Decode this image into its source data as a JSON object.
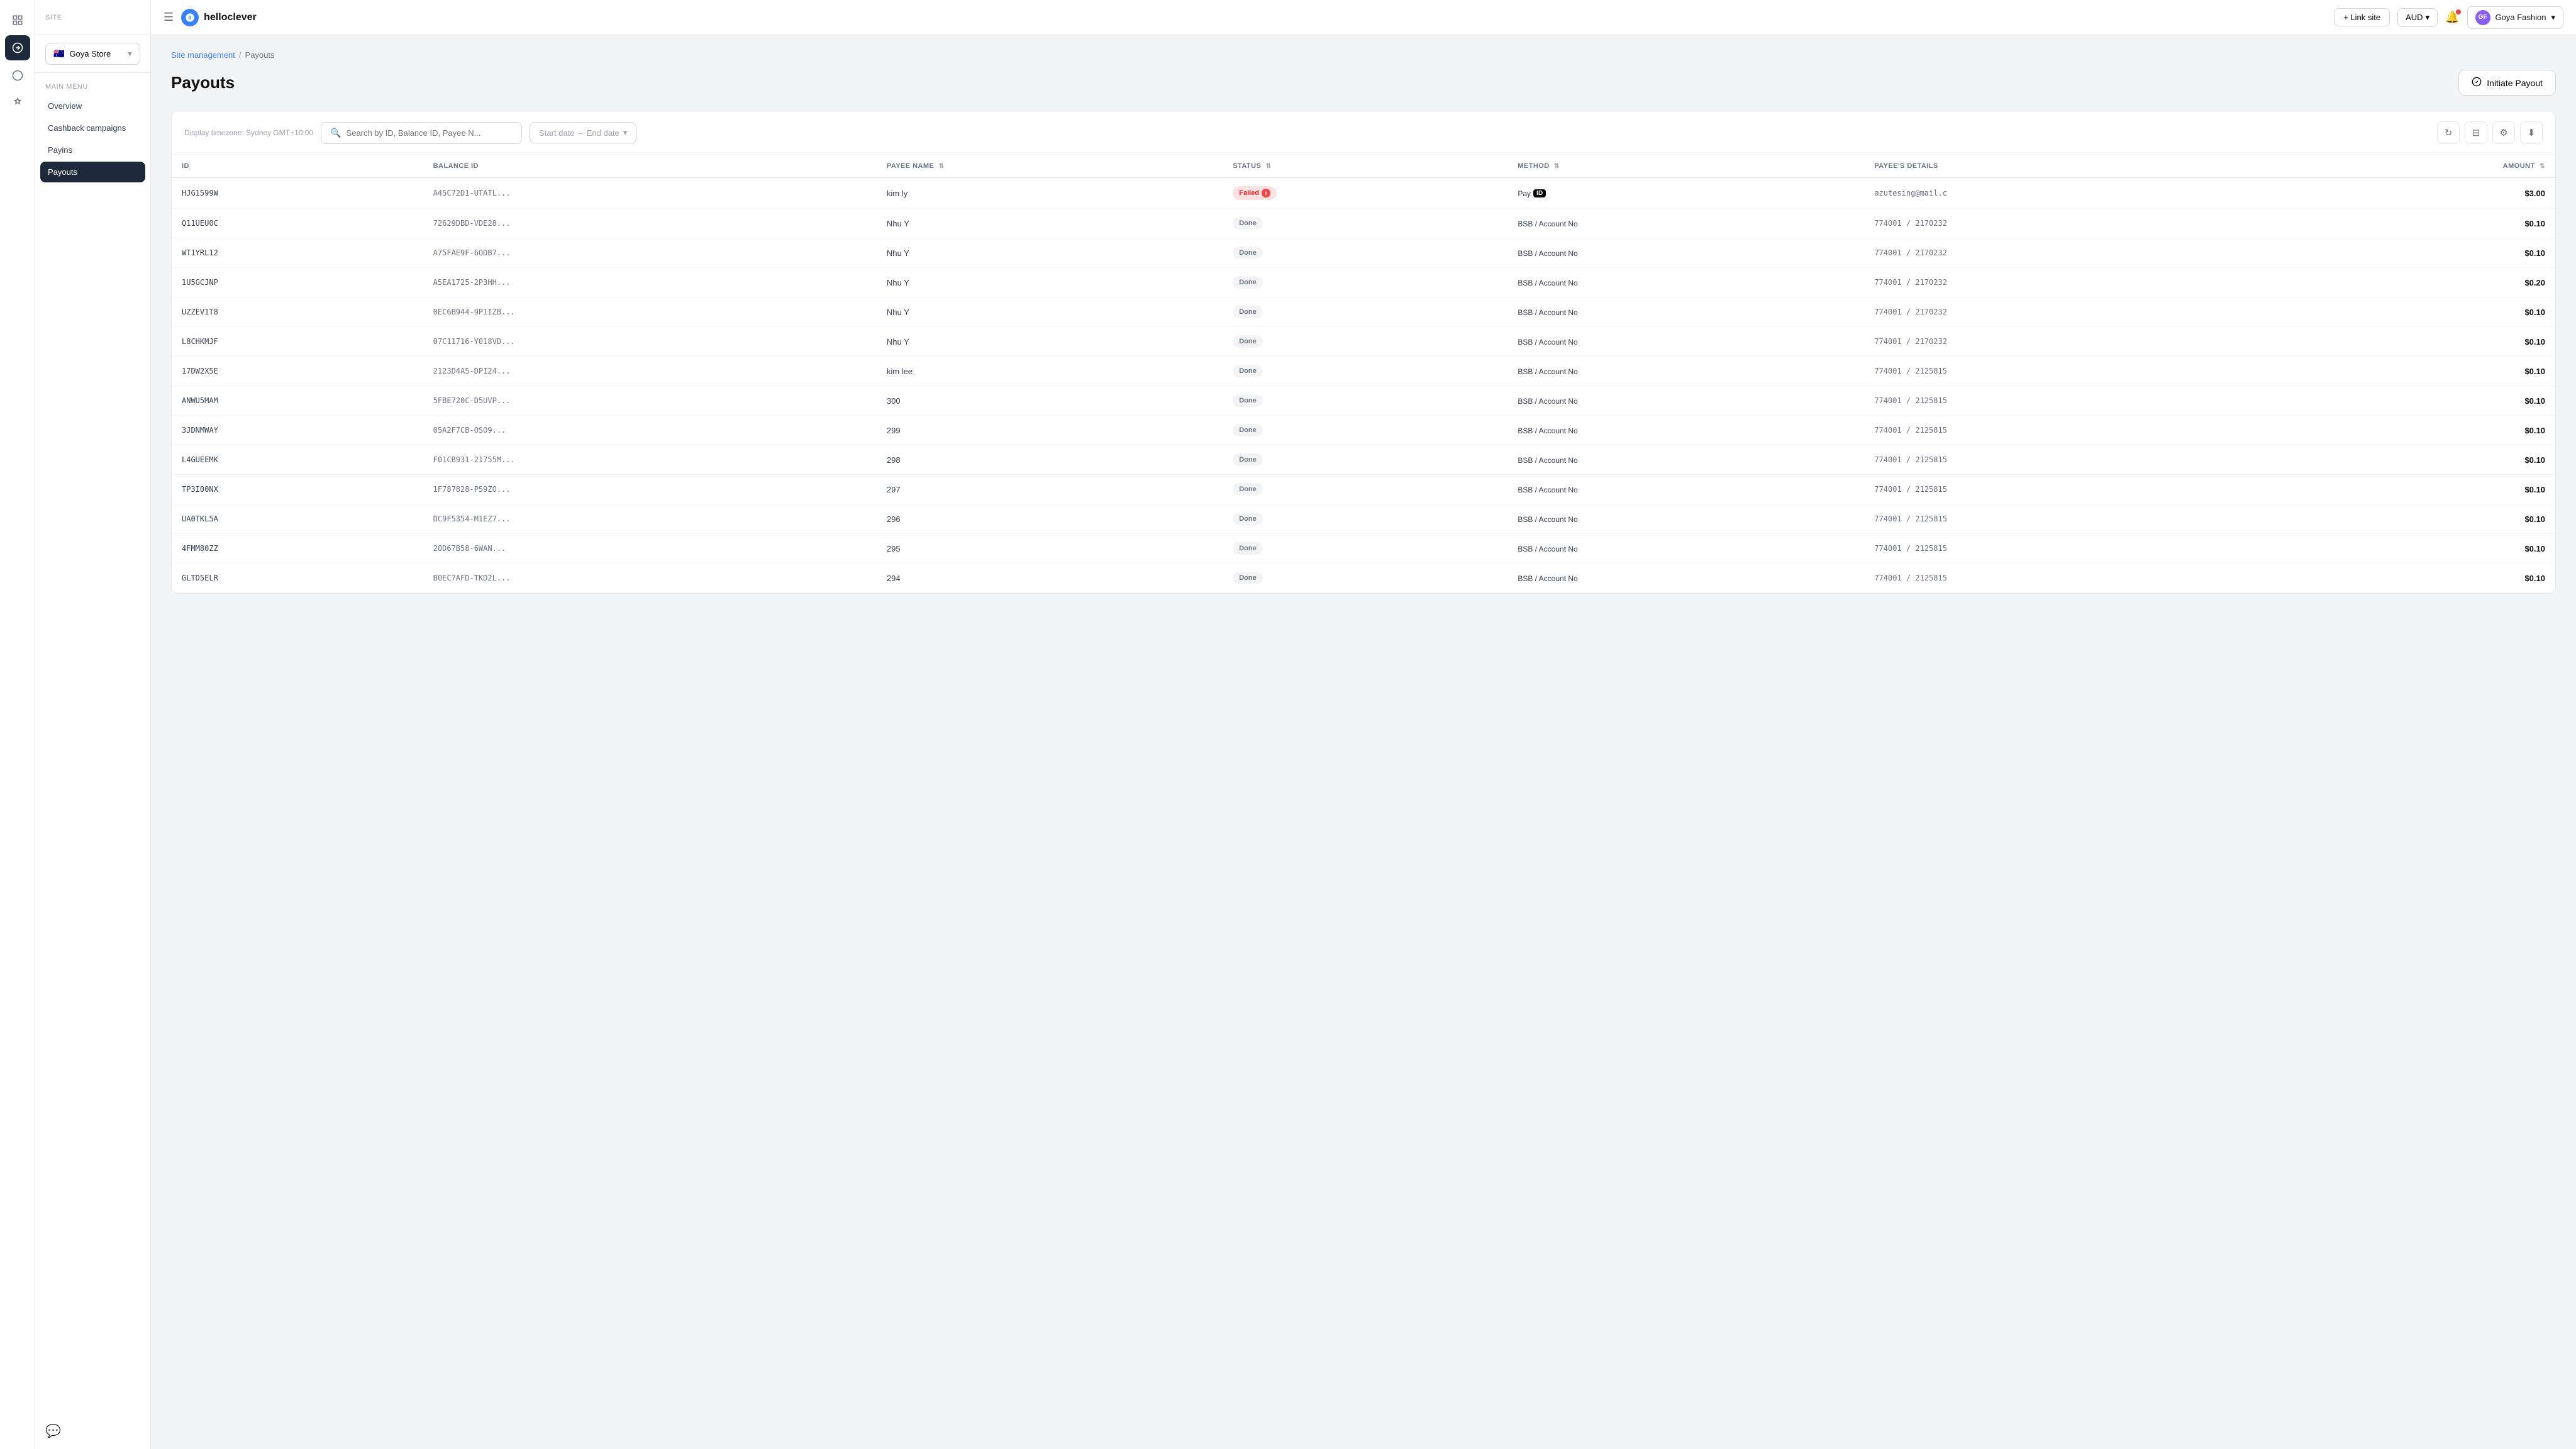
{
  "app": {
    "brand_name": "helloclever",
    "brand_icon_text": "hc"
  },
  "topbar": {
    "menu_icon": "☰",
    "link_site_label": "+ Link site",
    "currency_label": "AUD",
    "currency_dropdown_icon": "▾",
    "notification_icon": "🔔",
    "user_name": "Goya Fashion",
    "user_avatar_text": "GF",
    "user_dropdown_icon": "▾"
  },
  "sidebar": {
    "site_section_label": "SITE",
    "site_name": "Goya Store",
    "site_flag": "🇦🇺",
    "site_dropdown_icon": "▾",
    "nav_section_label": "MAIN MENU",
    "nav_items": [
      {
        "id": "overview",
        "label": "Overview",
        "active": false
      },
      {
        "id": "cashback",
        "label": "Cashback campaigns",
        "active": false
      },
      {
        "id": "payins",
        "label": "Payins",
        "active": false
      },
      {
        "id": "payouts",
        "label": "Payouts",
        "active": true
      }
    ],
    "collapse_icon": "‹",
    "support_icon": "💬"
  },
  "page": {
    "breadcrumb_site_management": "Site management",
    "breadcrumb_separator": "/",
    "breadcrumb_current": "Payouts",
    "title": "Payouts",
    "initiate_button_label": "Initiate Payout",
    "initiate_button_icon": "⊙"
  },
  "toolbar": {
    "timezone_label": "Display timezone: Sydney GMT+10:00",
    "search_placeholder": "Search by ID, Balance ID, Payee N...",
    "date_start_placeholder": "Start date",
    "date_end_placeholder": "End date",
    "date_separator": "–",
    "refresh_icon": "↻",
    "filter_icon": "⊟",
    "settings_icon": "⚙",
    "download_icon": "⬇"
  },
  "table": {
    "columns": [
      {
        "id": "id",
        "label": "ID"
      },
      {
        "id": "balance_id",
        "label": "BALANCE ID"
      },
      {
        "id": "payee_name",
        "label": "PAYEE NAME",
        "sortable": true
      },
      {
        "id": "status",
        "label": "STATUS",
        "sortable": true
      },
      {
        "id": "method",
        "label": "METHOD",
        "sortable": true
      },
      {
        "id": "payee_details",
        "label": "PAYEE'S DETAILS"
      },
      {
        "id": "amount",
        "label": "AMOUNT",
        "sortable": true
      }
    ],
    "rows": [
      {
        "id": "HJG1599W",
        "balance_id": "A45C72D1-UTATL...",
        "payee_name": "kim ly",
        "status": "Failed",
        "status_type": "failed",
        "method": "Pay",
        "method_badge": "ID",
        "payee_details": "azutesing@mail.c",
        "amount": "$3.00"
      },
      {
        "id": "Q11UEU0C",
        "balance_id": "72629DBD-VDE28...",
        "payee_name": "Nhu Y",
        "status": "Done",
        "status_type": "done",
        "method": "BSB / Account No",
        "method_badge": "",
        "payee_details": "774001 / 2170232",
        "amount": "$0.10"
      },
      {
        "id": "WT1YRL12",
        "balance_id": "A75FAE9F-6ODB7...",
        "payee_name": "Nhu Y",
        "status": "Done",
        "status_type": "done",
        "method": "BSB / Account No",
        "method_badge": "",
        "payee_details": "774001 / 2170232",
        "amount": "$0.10"
      },
      {
        "id": "1U5GCJNP",
        "balance_id": "A5EA1725-2P3HH...",
        "payee_name": "Nhu Y",
        "status": "Done",
        "status_type": "done",
        "method": "BSB / Account No",
        "method_badge": "",
        "payee_details": "774001 / 2170232",
        "amount": "$0.20"
      },
      {
        "id": "UZZEV1T8",
        "balance_id": "0EC6B944-9P1IZB...",
        "payee_name": "Nhu Y",
        "status": "Done",
        "status_type": "done",
        "method": "BSB / Account No",
        "method_badge": "",
        "payee_details": "774001 / 2170232",
        "amount": "$0.10"
      },
      {
        "id": "L8CHKMJF",
        "balance_id": "07C11716-Y018VD...",
        "payee_name": "Nhu Y",
        "status": "Done",
        "status_type": "done",
        "method": "BSB / Account No",
        "method_badge": "",
        "payee_details": "774001 / 2170232",
        "amount": "$0.10"
      },
      {
        "id": "17DW2X5E",
        "balance_id": "2123D4A5-DPI24...",
        "payee_name": "kim lee",
        "status": "Done",
        "status_type": "done",
        "method": "BSB / Account No",
        "method_badge": "",
        "payee_details": "774001 / 2125815",
        "amount": "$0.10"
      },
      {
        "id": "ANWU5MAM",
        "balance_id": "5FBE720C-D5UVP...",
        "payee_name": "300",
        "status": "Done",
        "status_type": "done",
        "method": "BSB / Account No",
        "method_badge": "",
        "payee_details": "774001 / 2125815",
        "amount": "$0.10"
      },
      {
        "id": "3JDNMWAY",
        "balance_id": "05A2F7CB-OSO9...",
        "payee_name": "299",
        "status": "Done",
        "status_type": "done",
        "method": "BSB / Account No",
        "method_badge": "",
        "payee_details": "774001 / 2125815",
        "amount": "$0.10"
      },
      {
        "id": "L4GUEEMK",
        "balance_id": "F01CB931-21755M...",
        "payee_name": "298",
        "status": "Done",
        "status_type": "done",
        "method": "BSB / Account No",
        "method_badge": "",
        "payee_details": "774001 / 2125815",
        "amount": "$0.10"
      },
      {
        "id": "TP3I00NX",
        "balance_id": "1F787828-P59ZO...",
        "payee_name": "297",
        "status": "Done",
        "status_type": "done",
        "method": "BSB / Account No",
        "method_badge": "",
        "payee_details": "774001 / 2125815",
        "amount": "$0.10"
      },
      {
        "id": "UA0TKL5A",
        "balance_id": "DC9F5354-M1EZ7...",
        "payee_name": "296",
        "status": "Done",
        "status_type": "done",
        "method": "BSB / Account No",
        "method_badge": "",
        "payee_details": "774001 / 2125815",
        "amount": "$0.10"
      },
      {
        "id": "4FMM80ZZ",
        "balance_id": "20D67B58-6WAN...",
        "payee_name": "295",
        "status": "Done",
        "status_type": "done",
        "method": "BSB / Account No",
        "method_badge": "",
        "payee_details": "774001 / 2125815",
        "amount": "$0.10"
      },
      {
        "id": "GLTD5ELR",
        "balance_id": "B0EC7AFD-TKD2L...",
        "payee_name": "294",
        "status": "Done",
        "status_type": "done",
        "method": "BSB / Account No",
        "method_badge": "",
        "payee_details": "774001 / 2125815",
        "amount": "$0.10"
      }
    ]
  }
}
